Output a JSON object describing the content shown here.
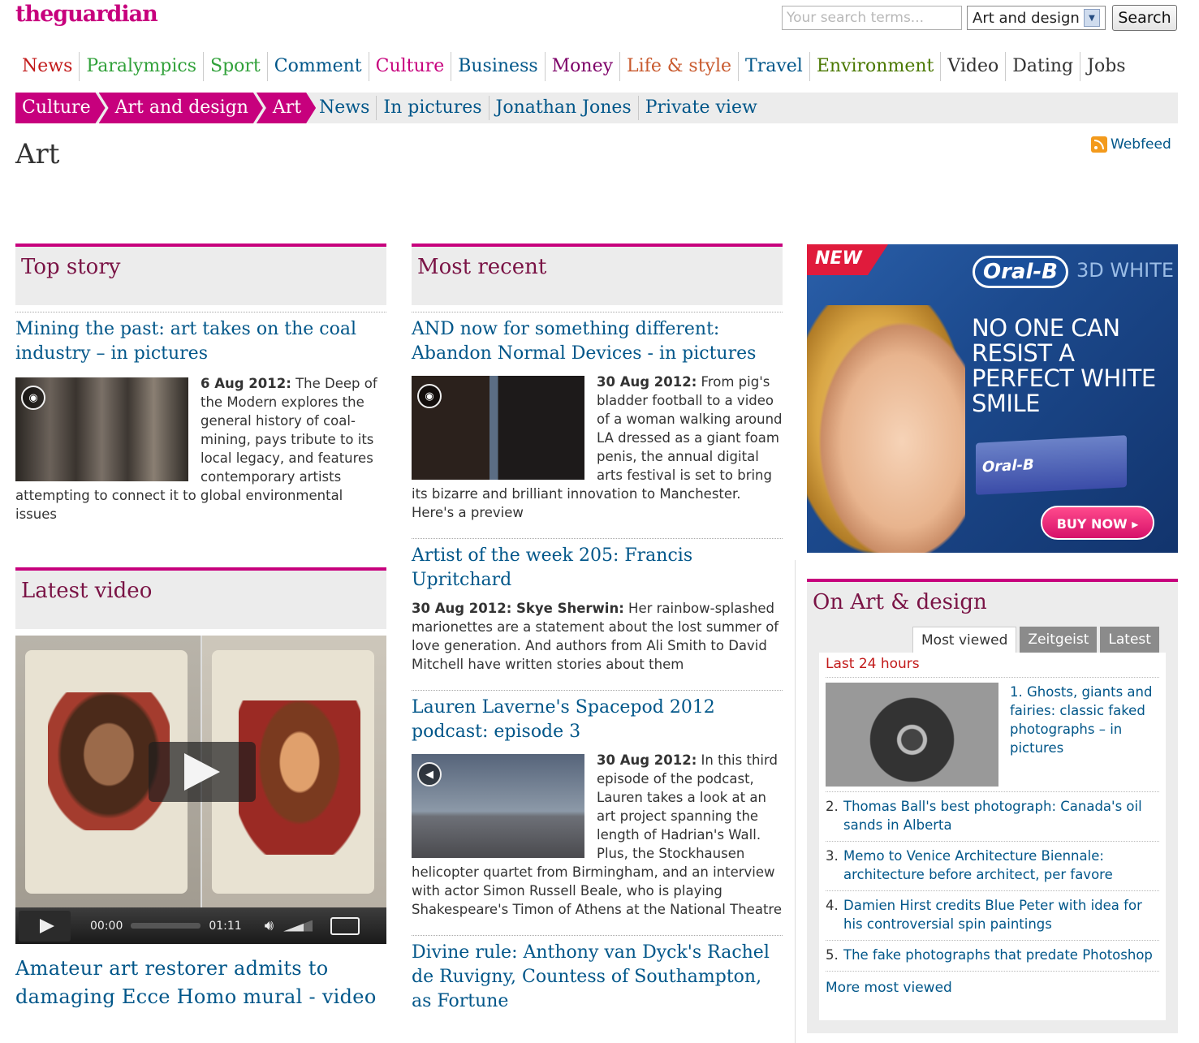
{
  "header": {
    "logo_the": "the",
    "logo_guardian": "guardian",
    "search_placeholder": "Your search terms...",
    "section_select": "Art and design",
    "search_button": "Search"
  },
  "topnav": [
    {
      "label": "News",
      "color": "#c21a1a"
    },
    {
      "label": "Paralympics",
      "color": "#31a13a"
    },
    {
      "label": "Sport",
      "color": "#31a13a"
    },
    {
      "label": "Comment",
      "color": "#005689"
    },
    {
      "label": "Culture",
      "color": "#c7007d"
    },
    {
      "label": "Business",
      "color": "#005689"
    },
    {
      "label": "Money",
      "color": "#7d0068"
    },
    {
      "label": "Life & style",
      "color": "#c8592d"
    },
    {
      "label": "Travel",
      "color": "#005689"
    },
    {
      "label": "Environment",
      "color": "#4a7801"
    },
    {
      "label": "Video",
      "color": "#333333"
    },
    {
      "label": "Dating",
      "color": "#333333"
    },
    {
      "label": "Jobs",
      "color": "#333333"
    }
  ],
  "breadcrumb": [
    "Culture",
    "Art and design",
    "Art"
  ],
  "sublinks": [
    "News",
    "In pictures",
    "Jonathan Jones",
    "Private view"
  ],
  "page_title": "Art",
  "webfeed": "Webfeed",
  "top_story": {
    "heading": "Top story",
    "headline": "Mining the past: art takes on the coal industry – in pictures",
    "date": "6 Aug 2012:",
    "text": " The Deep of the Modern explores the general history of coal-mining, pays tribute to its local legacy, and features contemporary artists attempting to connect it to global environmental issues"
  },
  "latest_video": {
    "heading": "Latest video",
    "time_current": "00:00",
    "time_total": "01:11",
    "headline": "Amateur art restorer admits to damaging Ecce Homo mural - video"
  },
  "most_recent": {
    "heading": "Most recent",
    "items": [
      {
        "headline": "AND now for something different: Abandon Normal Devices - in pictures",
        "date": "30 Aug 2012:",
        "text": " From pig's bladder football to a video of a woman walking around LA dressed as a giant foam penis, the annual digital arts festival is set to bring its bizarre and brilliant innovation to Manchester. Here's a preview"
      },
      {
        "headline": "Artist of the week 205: Francis Upritchard",
        "date": "30 Aug 2012: Skye Sherwin:",
        "text": " Her rainbow-splashed marionettes are a statement about the lost summer of love generation. And authors from Ali Smith to David Mitchell have written stories about them"
      },
      {
        "headline": "Lauren Laverne's Spacepod 2012 podcast: episode 3",
        "date": "30 Aug 2012:",
        "text": " In this third episode of the podcast, Lauren takes a look at an art project spanning the length of Hadrian's Wall. Plus, the Stockhausen helicopter quartet from Birmingham, and an interview with actor Simon Russell Beale, who is playing Shakespeare's Timon of Athens at the National Theatre"
      },
      {
        "headline": "Divine rule: Anthony van Dyck's Rachel de Ruvigny, Countess of Southampton, as Fortune"
      }
    ]
  },
  "ad": {
    "new": "NEW",
    "brand": "Oral-B",
    "brand_suffix": "3D WHITE",
    "tagline": "NO ONE CAN RESIST A PERFECT WHITE SMILE",
    "box_label": "Oral-B",
    "buy": "BUY NOW ▸"
  },
  "on_art": {
    "heading": "On Art & design",
    "tabs": [
      "Most viewed",
      "Zeitgeist",
      "Latest"
    ],
    "period": "Last 24 hours",
    "items": [
      "1. Ghosts, giants and fairies: classic faked photographs – in pictures",
      "Thomas Ball's best photograph: Canada's oil sands in Alberta",
      "Memo to Venice Architecture Biennale: architecture before architect, per favore",
      "Damien Hirst credits Blue Peter with idea for his controversial spin paintings",
      "The fake photographs that predate Photoshop"
    ],
    "numbers": [
      "2.",
      "3.",
      "4.",
      "5."
    ],
    "more": "More most viewed"
  }
}
